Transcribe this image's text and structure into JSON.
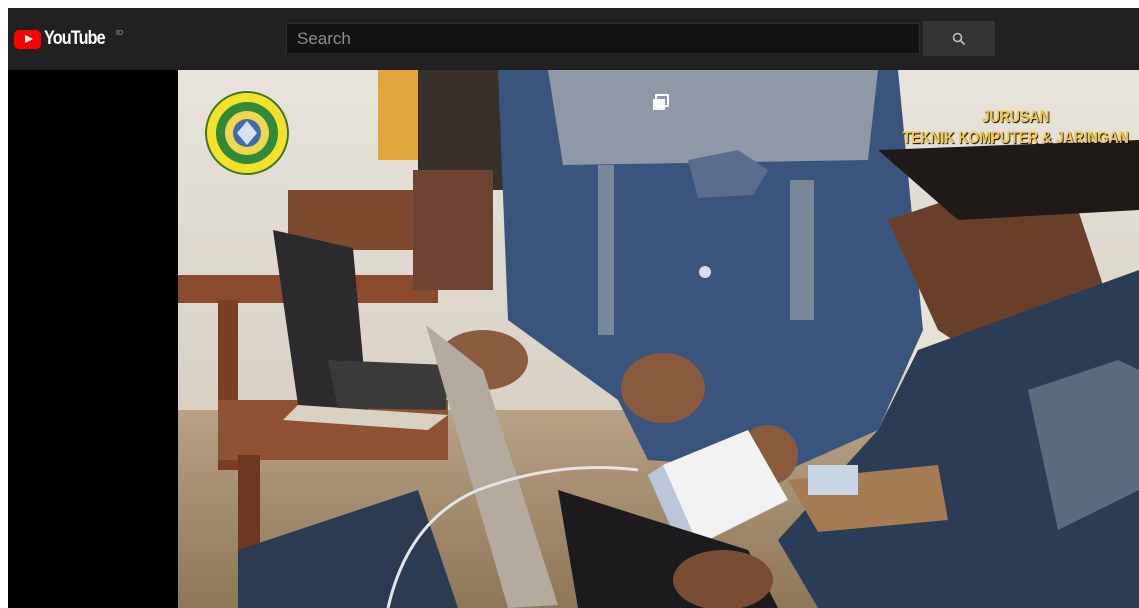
{
  "header": {
    "logo_text": "YouTube",
    "logo_superscript": "ID",
    "search_placeholder": "Search",
    "search_button_icon": "search-icon"
  },
  "video": {
    "overlay_line1": "JURUSAN",
    "overlay_line2": "TEKNIK KOMPUTER & JARINGAN",
    "overlay_color": "#f4c843",
    "pip_icon": "picture-in-picture-icon",
    "badge_icon": "school-emblem-icon"
  },
  "colors": {
    "brand_red": "#ff0000",
    "topbar": "#212121",
    "search_bg": "#121212",
    "search_button": "#333333"
  }
}
